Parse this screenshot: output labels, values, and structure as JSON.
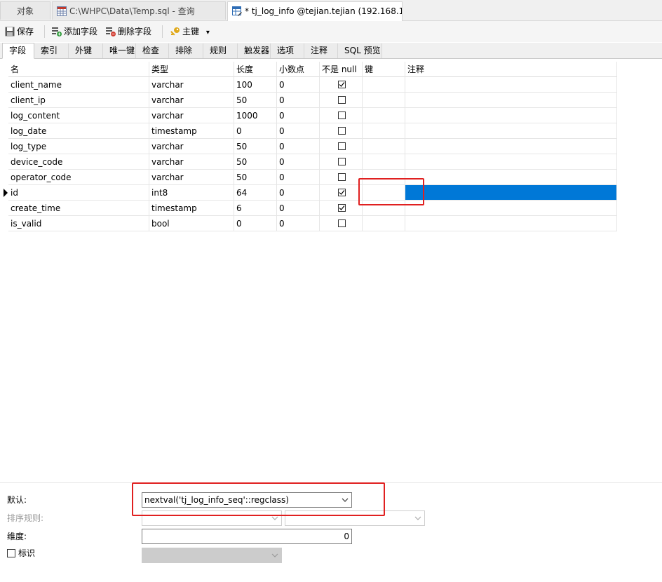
{
  "doc_tabs": [
    {
      "label": "对象"
    },
    {
      "label": "C:\\WHPC\\Data\\Temp.sql - 查询"
    },
    {
      "label": "* tj_log_info @tejian.tejian (192.168.1..."
    }
  ],
  "toolbar": {
    "save": "保存",
    "add_field": "添加字段",
    "delete_field": "删除字段",
    "primary_key": "主键",
    "primary_key_arrow": "▾"
  },
  "prop_tabs": [
    "字段",
    "索引",
    "外键",
    "唯一键",
    "检查",
    "排除",
    "规则",
    "触发器",
    "选项",
    "注释",
    "SQL 预览"
  ],
  "grid": {
    "headers": [
      "名",
      "类型",
      "长度",
      "小数点",
      "不是 null",
      "键",
      "注释"
    ],
    "rows": [
      {
        "name": "client_name",
        "type": "varchar",
        "length": "100",
        "decimals": "0",
        "not_null": true
      },
      {
        "name": "client_ip",
        "type": "varchar",
        "length": "50",
        "decimals": "0",
        "not_null": false
      },
      {
        "name": "log_content",
        "type": "varchar",
        "length": "1000",
        "decimals": "0",
        "not_null": false
      },
      {
        "name": "log_date",
        "type": "timestamp",
        "length": "0",
        "decimals": "0",
        "not_null": false
      },
      {
        "name": "log_type",
        "type": "varchar",
        "length": "50",
        "decimals": "0",
        "not_null": false
      },
      {
        "name": "device_code",
        "type": "varchar",
        "length": "50",
        "decimals": "0",
        "not_null": false
      },
      {
        "name": "operator_code",
        "type": "varchar",
        "length": "50",
        "decimals": "0",
        "not_null": false
      },
      {
        "name": "id",
        "type": "int8",
        "length": "64",
        "decimals": "0",
        "not_null": true
      },
      {
        "name": "create_time",
        "type": "timestamp",
        "length": "6",
        "decimals": "0",
        "not_null": true
      },
      {
        "name": "is_valid",
        "type": "bool",
        "length": "0",
        "decimals": "0",
        "not_null": false
      }
    ]
  },
  "properties": {
    "default_label": "默认:",
    "default_value": "nextval('tj_log_info_seq'::regclass)",
    "collation_label": "排序规则:",
    "dimension_label": "维度:",
    "dimension_value": "0",
    "identity_label": "标识"
  },
  "colors": {
    "selection": "#0078d7",
    "highlight_box": "#e02020"
  }
}
